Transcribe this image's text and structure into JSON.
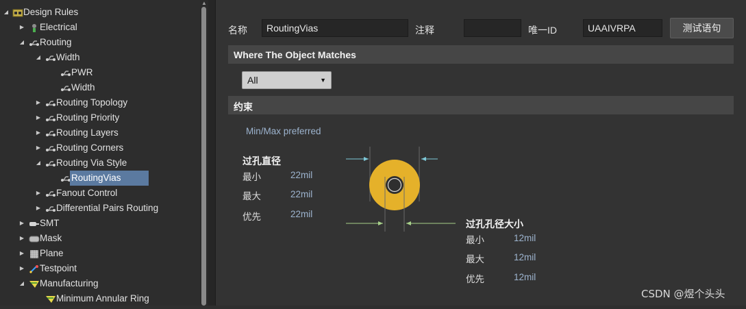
{
  "tree": {
    "items": [
      {
        "label": "Design Rules",
        "depth": 0,
        "expanded": true,
        "icon": "design-rules-icon"
      },
      {
        "label": "Electrical",
        "depth": 1,
        "expanded": false,
        "icon": "electrical-icon"
      },
      {
        "label": "Routing",
        "depth": 1,
        "expanded": true,
        "icon": "rule-icon"
      },
      {
        "label": "Width",
        "depth": 2,
        "expanded": true,
        "icon": "rule-icon"
      },
      {
        "label": "PWR",
        "depth": 3,
        "expanded": null,
        "icon": "rule-icon"
      },
      {
        "label": "Width",
        "depth": 3,
        "expanded": null,
        "icon": "rule-icon"
      },
      {
        "label": "Routing Topology",
        "depth": 2,
        "expanded": false,
        "icon": "rule-icon"
      },
      {
        "label": "Routing Priority",
        "depth": 2,
        "expanded": false,
        "icon": "rule-icon"
      },
      {
        "label": "Routing Layers",
        "depth": 2,
        "expanded": false,
        "icon": "rule-icon"
      },
      {
        "label": "Routing Corners",
        "depth": 2,
        "expanded": false,
        "icon": "rule-icon"
      },
      {
        "label": "Routing Via Style",
        "depth": 2,
        "expanded": true,
        "icon": "rule-icon"
      },
      {
        "label": "RoutingVias",
        "depth": 3,
        "expanded": null,
        "icon": "rule-icon",
        "selected": true
      },
      {
        "label": "Fanout Control",
        "depth": 2,
        "expanded": false,
        "icon": "rule-icon"
      },
      {
        "label": "Differential Pairs Routing",
        "depth": 2,
        "expanded": false,
        "icon": "rule-icon"
      },
      {
        "label": "SMT",
        "depth": 1,
        "expanded": false,
        "icon": "smt-icon"
      },
      {
        "label": "Mask",
        "depth": 1,
        "expanded": false,
        "icon": "mask-icon"
      },
      {
        "label": "Plane",
        "depth": 1,
        "expanded": false,
        "icon": "plane-icon"
      },
      {
        "label": "Testpoint",
        "depth": 1,
        "expanded": false,
        "icon": "testpoint-icon"
      },
      {
        "label": "Manufacturing",
        "depth": 1,
        "expanded": true,
        "icon": "manufacturing-icon"
      },
      {
        "label": "Minimum Annular Ring",
        "depth": 2,
        "expanded": null,
        "icon": "manufacturing-icon"
      }
    ]
  },
  "header": {
    "name_label": "名称",
    "name_value": "RoutingVias",
    "comment_label": "注释",
    "comment_value": "",
    "uid_label": "唯一ID",
    "uid_value": "UAAIVRPA",
    "test_button": "测试语句"
  },
  "match": {
    "section_title": "Where The Object Matches",
    "selected": "All"
  },
  "constraints": {
    "section_title": "约束",
    "mode": "Min/Max preferred",
    "via_diameter": {
      "title": "过孔直径",
      "rows": [
        {
          "key": "最小",
          "value": "22mil"
        },
        {
          "key": "最大",
          "value": "22mil"
        },
        {
          "key": "优先",
          "value": "22mil"
        }
      ]
    },
    "hole_size": {
      "title": "过孔孔径大小",
      "rows": [
        {
          "key": "最小",
          "value": "12mil"
        },
        {
          "key": "最大",
          "value": "12mil"
        },
        {
          "key": "优先",
          "value": "12mil"
        }
      ]
    }
  },
  "colors": {
    "via_ring": "#e5b12a",
    "via_hole": "#2f2f2f",
    "diameter_arrow": "#7ec8d8",
    "hole_arrow": "#a7d08a",
    "selection": "#5b7aa0"
  },
  "watermark": "CSDN @煜个头头"
}
